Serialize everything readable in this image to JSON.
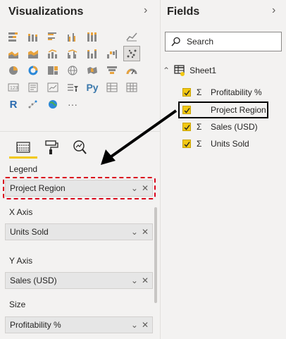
{
  "viz": {
    "title": "Visualizations",
    "icons": [
      "stacked-bar-icon",
      "stacked-column-icon",
      "clustered-bar-icon",
      "clustered-column-icon",
      "100-bar-icon",
      "line-chart-icon",
      "area-chart-icon",
      "stacked-area-icon",
      "line-column-icon",
      "line-clustered-icon",
      "ribbon-chart-icon",
      "scatter-chart-icon",
      "pie-chart-icon",
      "donut-chart-icon",
      "treemap-icon",
      "map-icon",
      "filled-map-icon",
      "funnel-icon",
      "gauge-icon",
      "card-icon",
      "multirow-card-icon",
      "kpi-icon",
      "slicer-icon",
      "python-visual-icon",
      "table-icon",
      "matrix-icon",
      "r-visual-icon",
      "key-influencers-icon",
      "globe-icon",
      "more-icon"
    ],
    "python_label": "Py",
    "r_label": "R",
    "more_label": "···",
    "selected_icon": "scatter-chart-icon",
    "wells": [
      {
        "label": "Legend",
        "value": "Project Region"
      },
      {
        "label": "X Axis",
        "value": "Units Sold"
      },
      {
        "label": "Y Axis",
        "value": "Sales (USD)"
      },
      {
        "label": "Size",
        "value": "Profitability %"
      }
    ]
  },
  "fields": {
    "title": "Fields",
    "search_placeholder": "Search",
    "table_name": "Sheet1",
    "items": [
      {
        "name": "Profitability %",
        "sigma": "Σ"
      },
      {
        "name": "Project Region",
        "sigma": ""
      },
      {
        "name": "Sales (USD)",
        "sigma": "Σ"
      },
      {
        "name": "Units Sold",
        "sigma": "Σ"
      }
    ]
  },
  "colors": {
    "accent": "#f2c811",
    "highlight_red": "#d9001b"
  }
}
